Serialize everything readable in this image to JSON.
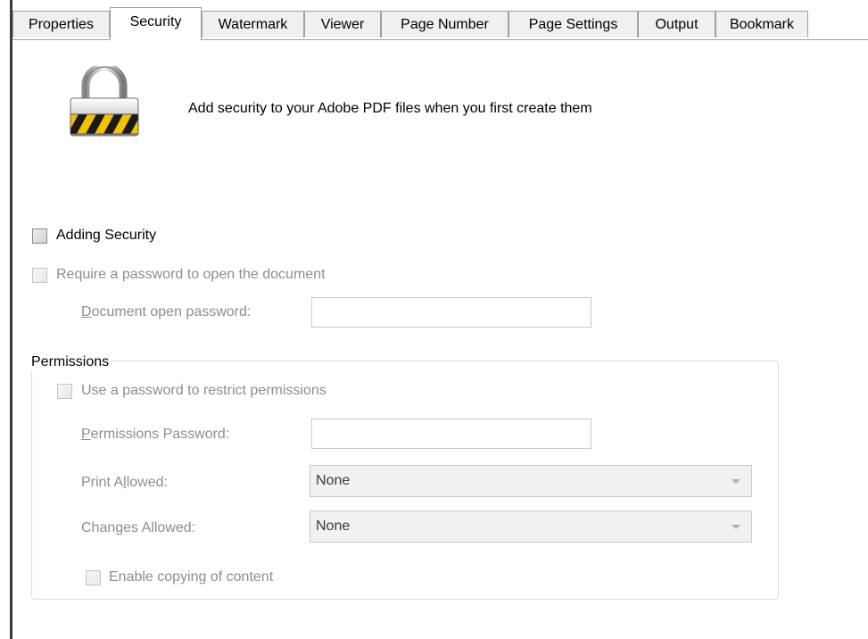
{
  "tabs": [
    {
      "label": "Properties",
      "active": false
    },
    {
      "label": "Security",
      "active": true
    },
    {
      "label": "Watermark",
      "active": false
    },
    {
      "label": "Viewer",
      "active": false
    },
    {
      "label": "Page Number",
      "active": false
    },
    {
      "label": "Page Settings",
      "active": false
    },
    {
      "label": "Output",
      "active": false
    },
    {
      "label": "Bookmark",
      "active": false
    }
  ],
  "header": {
    "icon": "lock-icon",
    "text": "Add security to your Adobe PDF files when you first create them"
  },
  "adding_security": {
    "label": "Adding Security",
    "checked": false
  },
  "require_password": {
    "label": "Require a password to open the document",
    "checked": false
  },
  "document_open_password": {
    "label_accel": "D",
    "label_rest": "ocument open password:",
    "value": ""
  },
  "permissions": {
    "title": "Permissions",
    "use_password": {
      "label": "Use a password to restrict permissions",
      "checked": false
    },
    "permissions_password": {
      "label_accel": "P",
      "label_rest": "ermissions Password:",
      "value": ""
    },
    "print_allowed": {
      "label_pre": "Print A",
      "label_accel": "l",
      "label_post": "lowed:",
      "value": "None"
    },
    "changes_allowed": {
      "label_pre": "Chan",
      "label_accel": "g",
      "label_post": "es Allowed:",
      "value": "None"
    },
    "enable_copying": {
      "label": "Enable copying of content",
      "checked": false
    }
  },
  "colors": {
    "disabled_text": "#8d8d8d",
    "tab_background": "#f0f0f0",
    "border": "#a0a0a0"
  }
}
